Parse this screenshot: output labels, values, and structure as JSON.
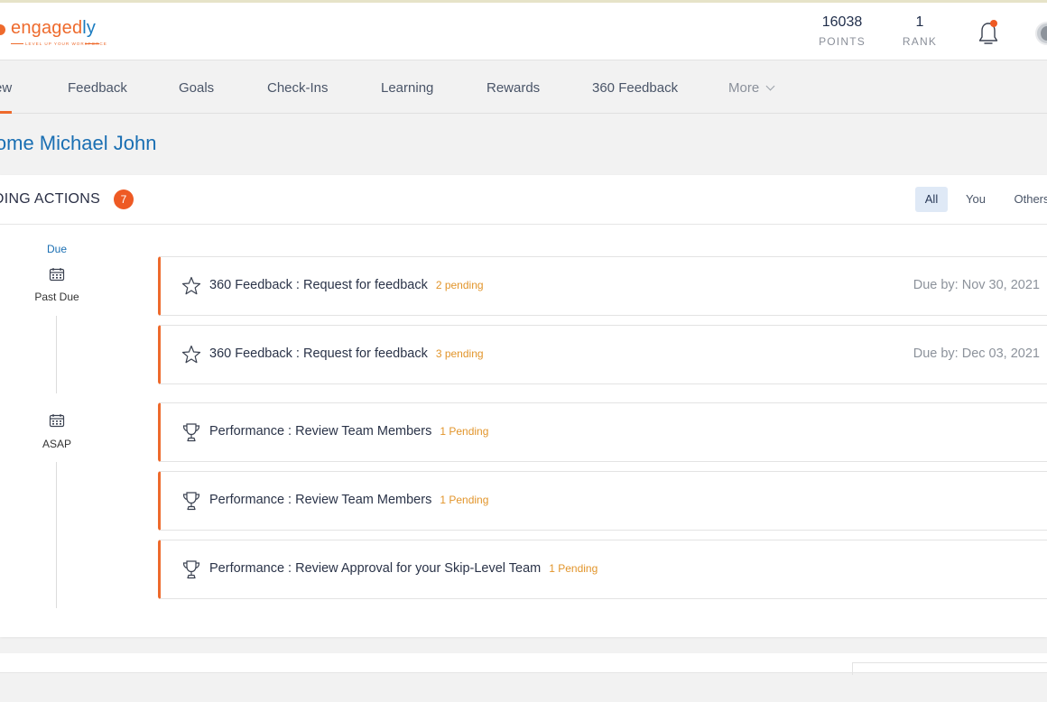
{
  "brand": {
    "name_main": "engaged",
    "name_accent": "ly",
    "tagline": "LEVEL UP YOUR WORKFORCE"
  },
  "stats": [
    {
      "value": "16038",
      "label": "POINTS"
    },
    {
      "value": "1",
      "label": "RANK"
    }
  ],
  "nav": {
    "items": [
      "ew",
      "Feedback",
      "Goals",
      "Check-Ins",
      "Learning",
      "Rewards",
      "360 Feedback"
    ],
    "more": "More",
    "active_index": 0
  },
  "welcome": "lcome Michael John",
  "pending_actions": {
    "title": "NDING ACTIONS",
    "count": "7",
    "filters": [
      "All",
      "You",
      "Others"
    ],
    "active_filter": "All",
    "timeline": {
      "due_label": "Due",
      "past_due": "Past Due",
      "asap": "ASAP"
    },
    "rows": [
      {
        "icon": "star-icon",
        "title": "360 Feedback : Request for feedback",
        "pending": "2 pending",
        "due": "Due by: Nov 30, 2021"
      },
      {
        "icon": "star-icon",
        "title": "360 Feedback : Request for feedback",
        "pending": "3 pending",
        "due": "Due by: Dec 03, 2021"
      },
      {
        "icon": "trophy-icon",
        "title": "Performance : Review Team Members",
        "pending": "1 Pending",
        "due": ""
      },
      {
        "icon": "trophy-icon",
        "title": "Performance : Review Team Members",
        "pending": "1 Pending",
        "due": ""
      },
      {
        "icon": "trophy-icon",
        "title": "Performance : Review Approval for your Skip-Level Team",
        "pending": "1 Pending",
        "due": ""
      }
    ]
  },
  "colors": {
    "accent": "#ee6a2c",
    "link": "#1a6fb3",
    "pending": "#e2952b",
    "badge": "#ee5a24"
  }
}
